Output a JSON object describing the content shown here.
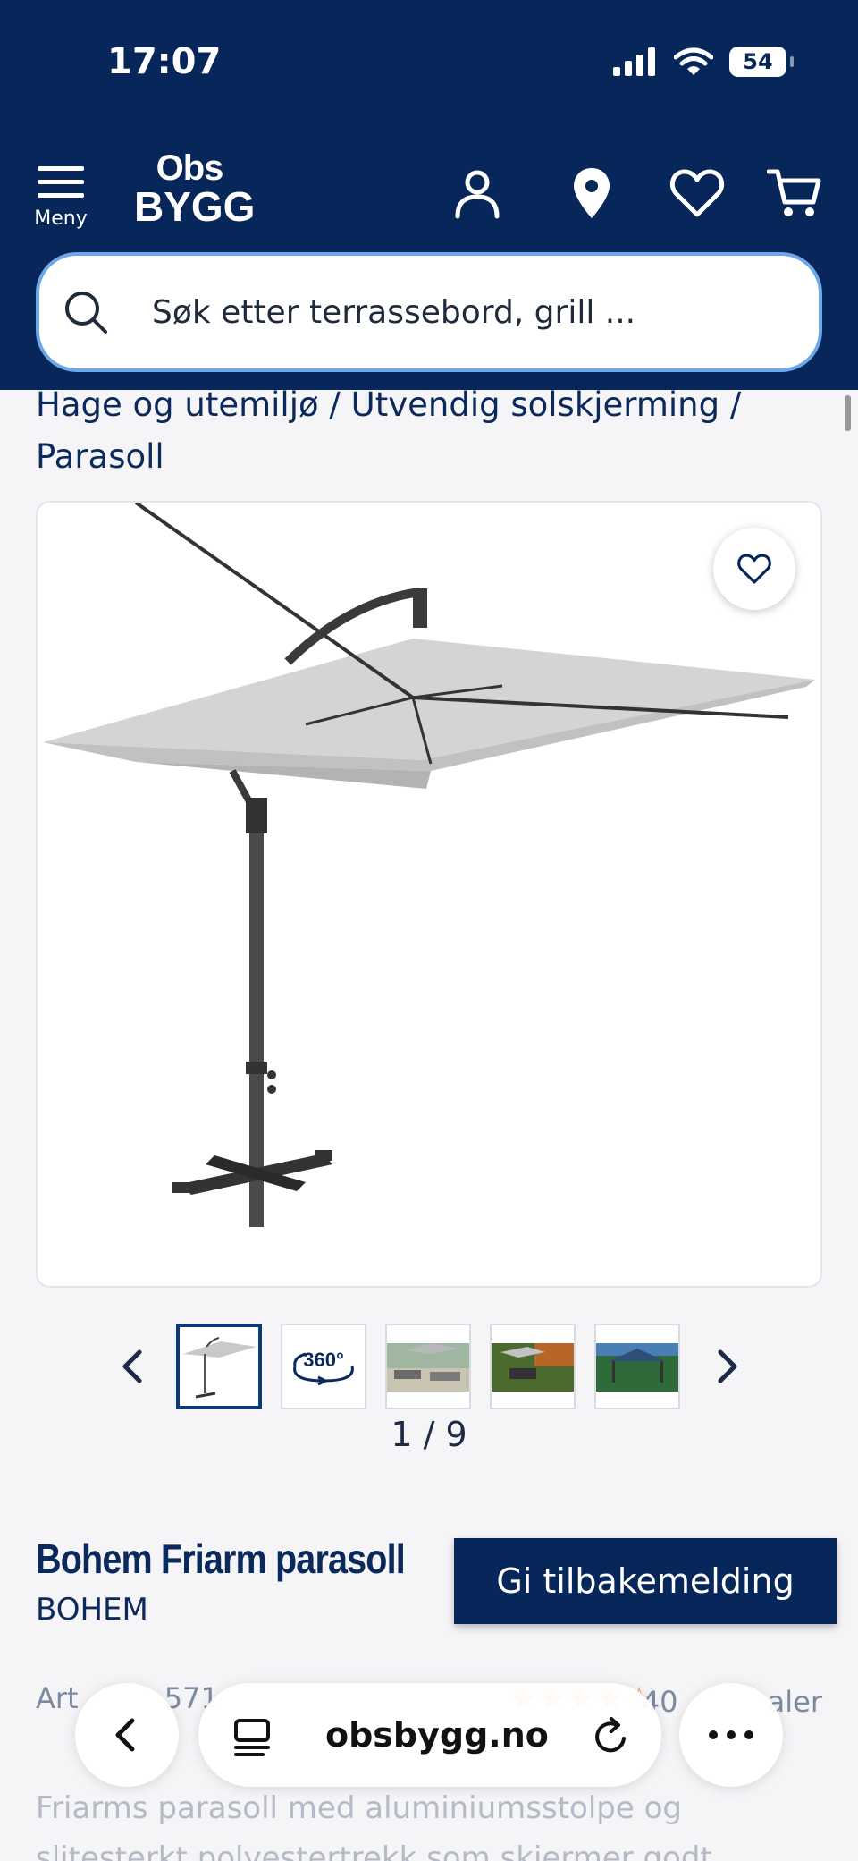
{
  "status_bar": {
    "time": "17:07",
    "battery": "54"
  },
  "header": {
    "menu_label": "Meny",
    "logo_line1": "Obs",
    "logo_line2": "BYGG",
    "search_placeholder": "Søk etter terrassebord, grill ...",
    "icons": [
      "account-icon",
      "location-pin-icon",
      "heart-icon",
      "cart-icon"
    ]
  },
  "breadcrumb": {
    "items": [
      "Hage og utemiljø",
      "Utvendig solskjerming",
      "Parasoll"
    ],
    "separator": "/"
  },
  "gallery": {
    "counter": "1 / 9",
    "thumbs": [
      "parasol-thumb",
      "360-view-thumb",
      "patio-thumb",
      "garden-thumb",
      "pavilion-thumb"
    ],
    "badge_360": "360°"
  },
  "product": {
    "title": "Bohem Friarm parasoll",
    "brand": "BOHEM",
    "feedback_label": "Gi tilbakemelding",
    "article_partial": "Art",
    "article_number_partial": "571",
    "reviews_partial": "40",
    "reviews_label_partial": "aler",
    "description": "Friarms parasoll med aluminiumsstolpe og slitesterkt polyestertrekk som skjermer godt"
  },
  "browser": {
    "url": "obsbygg.no"
  },
  "colors": {
    "brand_navy": "#07275a",
    "search_border": "#6fa8e8",
    "star": "#f3a46a"
  }
}
